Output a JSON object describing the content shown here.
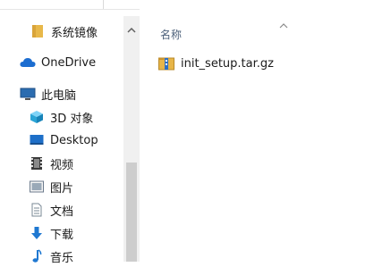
{
  "nav": {
    "items": [
      {
        "label": "系统镜像",
        "icon": "folder-icon"
      },
      {
        "label": "OneDrive",
        "icon": "onedrive-cloud-icon"
      },
      {
        "label": "此电脑",
        "icon": "this-pc-icon"
      },
      {
        "label": "3D 对象",
        "icon": "3d-objects-icon"
      },
      {
        "label": "Desktop",
        "icon": "desktop-icon"
      },
      {
        "label": "视频",
        "icon": "videos-icon"
      },
      {
        "label": "图片",
        "icon": "pictures-icon"
      },
      {
        "label": "文档",
        "icon": "documents-icon"
      },
      {
        "label": "下载",
        "icon": "downloads-icon"
      },
      {
        "label": "音乐",
        "icon": "music-icon"
      }
    ]
  },
  "content": {
    "column_header": "名称",
    "files": [
      {
        "name": "init_setup.tar.gz",
        "icon": "archive-icon"
      }
    ]
  },
  "colors": {
    "folder": "#e8b84a",
    "onedrive": "#1c6dd0",
    "header_text": "#4c607a",
    "scrollbar_track": "#f0f0f0",
    "scrollbar_thumb": "#cdcdcd"
  }
}
